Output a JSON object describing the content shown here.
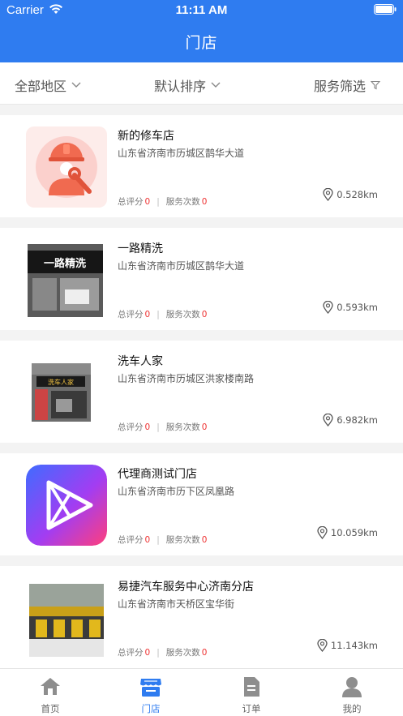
{
  "status_bar": {
    "carrier": "Carrier",
    "time": "11:11 AM"
  },
  "nav": {
    "title": "门店"
  },
  "filters": [
    {
      "label": "全部地区",
      "icon": "chevron-down-icon"
    },
    {
      "label": "默认排序",
      "icon": "chevron-down-icon"
    },
    {
      "label": "服务筛选",
      "icon": "funnel-icon"
    }
  ],
  "stores": [
    {
      "name": "新的修车店",
      "address": "山东省济南市历城区鹊华大道",
      "rating_label": "总评分",
      "rating": "0",
      "service_label": "服务次数",
      "service_count": "0",
      "distance": "0.528km"
    },
    {
      "name": "一路精洗",
      "address": "山东省济南市历城区鹊华大道",
      "rating_label": "总评分",
      "rating": "0",
      "service_label": "服务次数",
      "service_count": "0",
      "distance": "0.593km",
      "sign_text": "一路精洗"
    },
    {
      "name": "洗车人家",
      "address": "山东省济南市历城区洪家楼南路",
      "rating_label": "总评分",
      "rating": "0",
      "service_label": "服务次数",
      "service_count": "0",
      "distance": "6.982km",
      "sign_text": "洗车人家"
    },
    {
      "name": "代理商测试门店",
      "address": "山东省济南市历下区凤凰路",
      "rating_label": "总评分",
      "rating": "0",
      "service_label": "服务次数",
      "service_count": "0",
      "distance": "10.059km"
    },
    {
      "name": "易捷汽车服务中心济南分店",
      "address": "山东省济南市天桥区宝华街",
      "rating_label": "总评分",
      "rating": "0",
      "service_label": "服务次数",
      "service_count": "0",
      "distance": "11.143km"
    }
  ],
  "tabs": [
    {
      "label": "首页",
      "icon": "home-icon",
      "active": false
    },
    {
      "label": "门店",
      "icon": "store-icon",
      "active": true
    },
    {
      "label": "订单",
      "icon": "order-document-icon",
      "active": false
    },
    {
      "label": "我的",
      "icon": "profile-icon",
      "active": false
    }
  ],
  "colors": {
    "primary": "#2f7cf0",
    "highlight_number": "#e33333",
    "background": "#f3f3f3"
  }
}
